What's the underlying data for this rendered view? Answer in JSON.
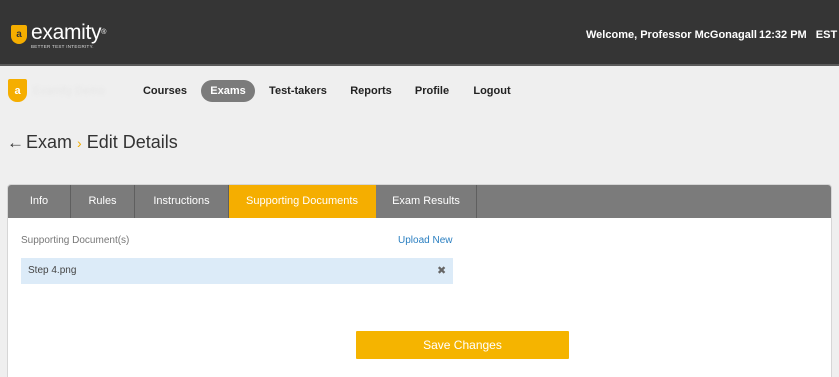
{
  "brand": {
    "name": "examity",
    "trademark": "®",
    "tagline": "BETTER TEST INTEGRITY.",
    "shield_glyph": "a",
    "accent": "#f5ae00",
    "topbar_bg": "#353535"
  },
  "header": {
    "welcome": "Welcome, Professor McGonagall",
    "time": "12:32 PM",
    "timezone": "EST"
  },
  "nav": {
    "institution_glyph": "a",
    "institution_name": "Examity Demo",
    "items": [
      {
        "label": "Courses",
        "active": false
      },
      {
        "label": "Exams",
        "active": true
      },
      {
        "label": "Test-takers",
        "active": false
      },
      {
        "label": "Reports",
        "active": false
      },
      {
        "label": "Profile",
        "active": false
      },
      {
        "label": "Logout",
        "active": false
      }
    ]
  },
  "breadcrumb": {
    "back_icon": "←",
    "parent": "Exam",
    "separator": "›",
    "current": "Edit Details"
  },
  "tabs": [
    {
      "label": "Info",
      "active": false
    },
    {
      "label": "Rules",
      "active": false
    },
    {
      "label": "Instructions",
      "active": false
    },
    {
      "label": "Supporting Documents",
      "active": true
    },
    {
      "label": "Exam Results",
      "active": false
    }
  ],
  "documents": {
    "section_label": "Supporting Document(s)",
    "upload_label": "Upload New",
    "files": [
      {
        "name": "Step 4.png",
        "remove_icon": "✖"
      }
    ]
  },
  "actions": {
    "save_label": "Save Changes"
  }
}
